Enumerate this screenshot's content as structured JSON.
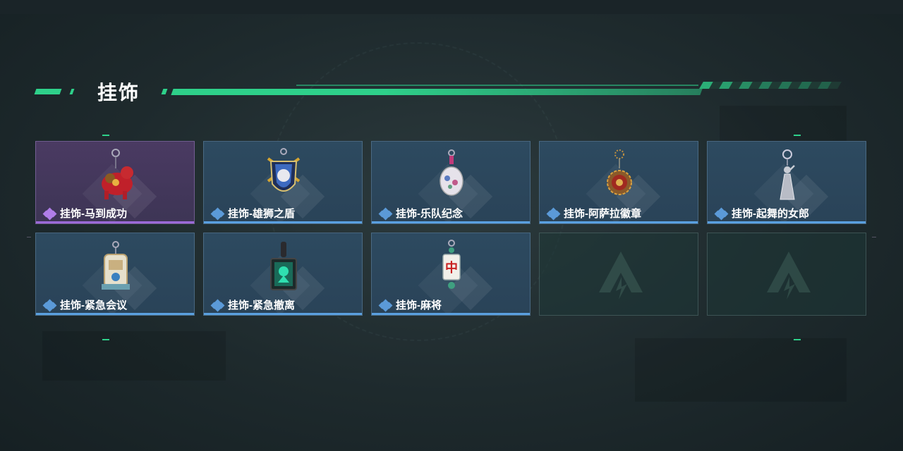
{
  "header": {
    "title": "挂饰"
  },
  "items": [
    {
      "label": "挂饰-马到成功",
      "rarity": "purple",
      "icon": "horse-charm-icon"
    },
    {
      "label": "挂饰-雄狮之盾",
      "rarity": "blue",
      "icon": "lion-shield-charm-icon"
    },
    {
      "label": "挂饰-乐队纪念",
      "rarity": "blue",
      "icon": "band-badge-charm-icon"
    },
    {
      "label": "挂饰-阿萨拉徽章",
      "rarity": "blue",
      "icon": "medallion-charm-icon"
    },
    {
      "label": "挂饰-起舞的女郎",
      "rarity": "blue",
      "icon": "dancer-statue-charm-icon"
    },
    {
      "label": "挂饰-紧急会议",
      "rarity": "blue",
      "icon": "emergency-meeting-charm-icon"
    },
    {
      "label": "挂饰-紧急撤离",
      "rarity": "blue",
      "icon": "emergency-evac-charm-icon"
    },
    {
      "label": "挂饰-麻将",
      "rarity": "blue",
      "icon": "mahjong-tile-charm-icon"
    }
  ],
  "empty_slots": 2,
  "colors": {
    "accent_green": "#2ed08a",
    "rarity_blue": "#5b9ad8",
    "rarity_purple": "#b07ee8"
  },
  "mahjong_glyph": "中"
}
